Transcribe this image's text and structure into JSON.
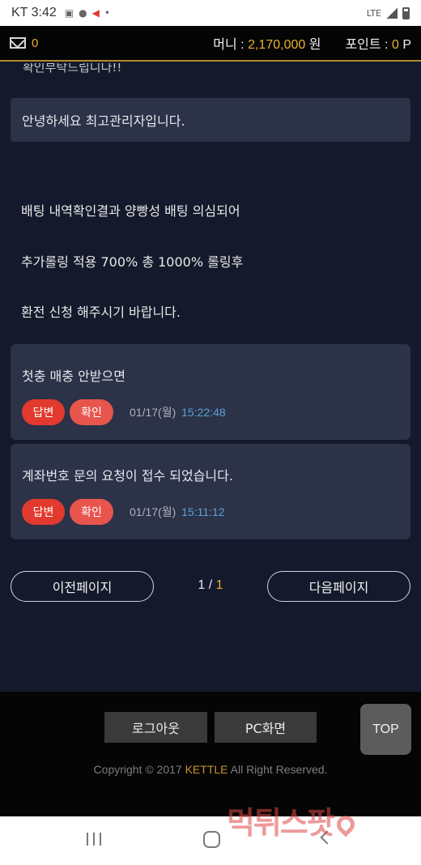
{
  "status_bar": {
    "carrier_time": "KT 3:42",
    "network": "LTE"
  },
  "header": {
    "mail_count": "0",
    "money_label": "머니 :",
    "money_value": "2,170,000",
    "money_unit": "원",
    "point_label": "포인트 :",
    "point_value": "0",
    "point_unit": "P"
  },
  "message": {
    "cut_text": "확인부탁드립니다!!",
    "greeting": "안녕하세요 최고관리자입니다.",
    "lines": [
      "배팅 내역확인결과 양빵성 배팅 의심되어",
      "추가롤링 적용 700% 총 1000% 롤링후",
      "환전 신청 해주시기 바랍니다."
    ]
  },
  "inquiries": [
    {
      "title": "첫충 매충 안받으면",
      "reply_label": "답변",
      "confirm_label": "확인",
      "date": "01/17(월)",
      "time": "15:22:48"
    },
    {
      "title": "계좌번호 문의 요청이 접수 되었습니다.",
      "reply_label": "답변",
      "confirm_label": "확인",
      "date": "01/17(월)",
      "time": "15:11:12"
    }
  ],
  "pager": {
    "prev_label": "이전페이지",
    "current": "1",
    "separator": " / ",
    "total": "1",
    "next_label": "다음페이지"
  },
  "footer": {
    "logout_label": "로그아웃",
    "pc_label": "PC화면",
    "top_label": "TOP",
    "copyright_pre": "Copyright © 2017 ",
    "copyright_brand": "KETTLE",
    "copyright_post": " All Right Reserved."
  },
  "watermark": "먹튀스팟",
  "colors": {
    "accent_gold": "#e8b030",
    "background": "#141a2b",
    "card": "#2c3248",
    "badge_red": "#e23a2e",
    "time_blue": "#5aa3d6"
  }
}
